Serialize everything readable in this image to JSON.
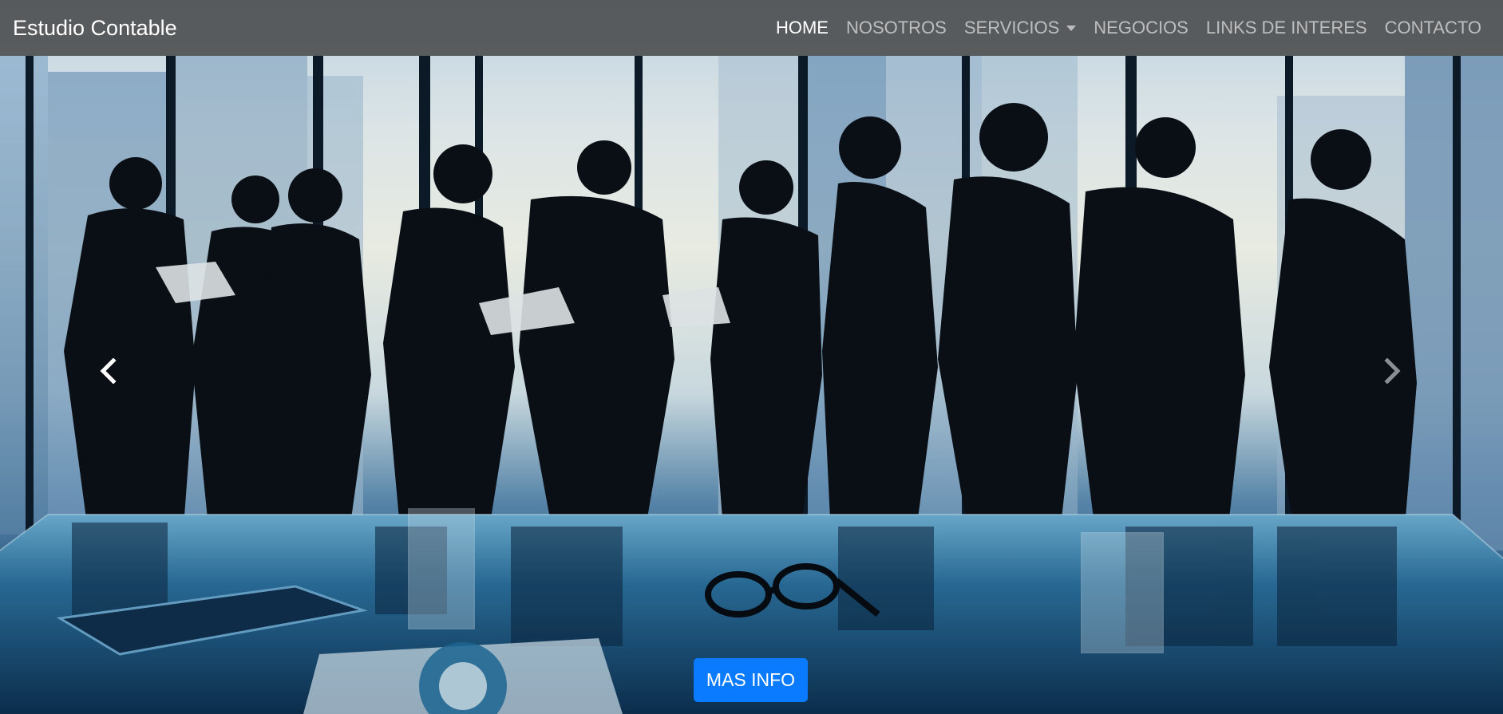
{
  "navbar": {
    "brand": "Estudio Contable",
    "items": [
      {
        "label": "HOME",
        "active": true
      },
      {
        "label": "NOSOTROS",
        "active": false
      },
      {
        "label": "SERVICIOS",
        "active": false,
        "dropdown": true
      },
      {
        "label": "NEGOCIOS",
        "active": false
      },
      {
        "label": "LINKS DE INTERES",
        "active": false
      },
      {
        "label": "CONTACTO",
        "active": false
      }
    ]
  },
  "carousel": {
    "prev_icon": "chevron-left-icon",
    "next_icon": "chevron-right-icon"
  },
  "hero": {
    "cta_label": "MAS INFO"
  },
  "colors": {
    "navbar_bg": "#3c3c3c",
    "cta": "#0a7bff"
  }
}
